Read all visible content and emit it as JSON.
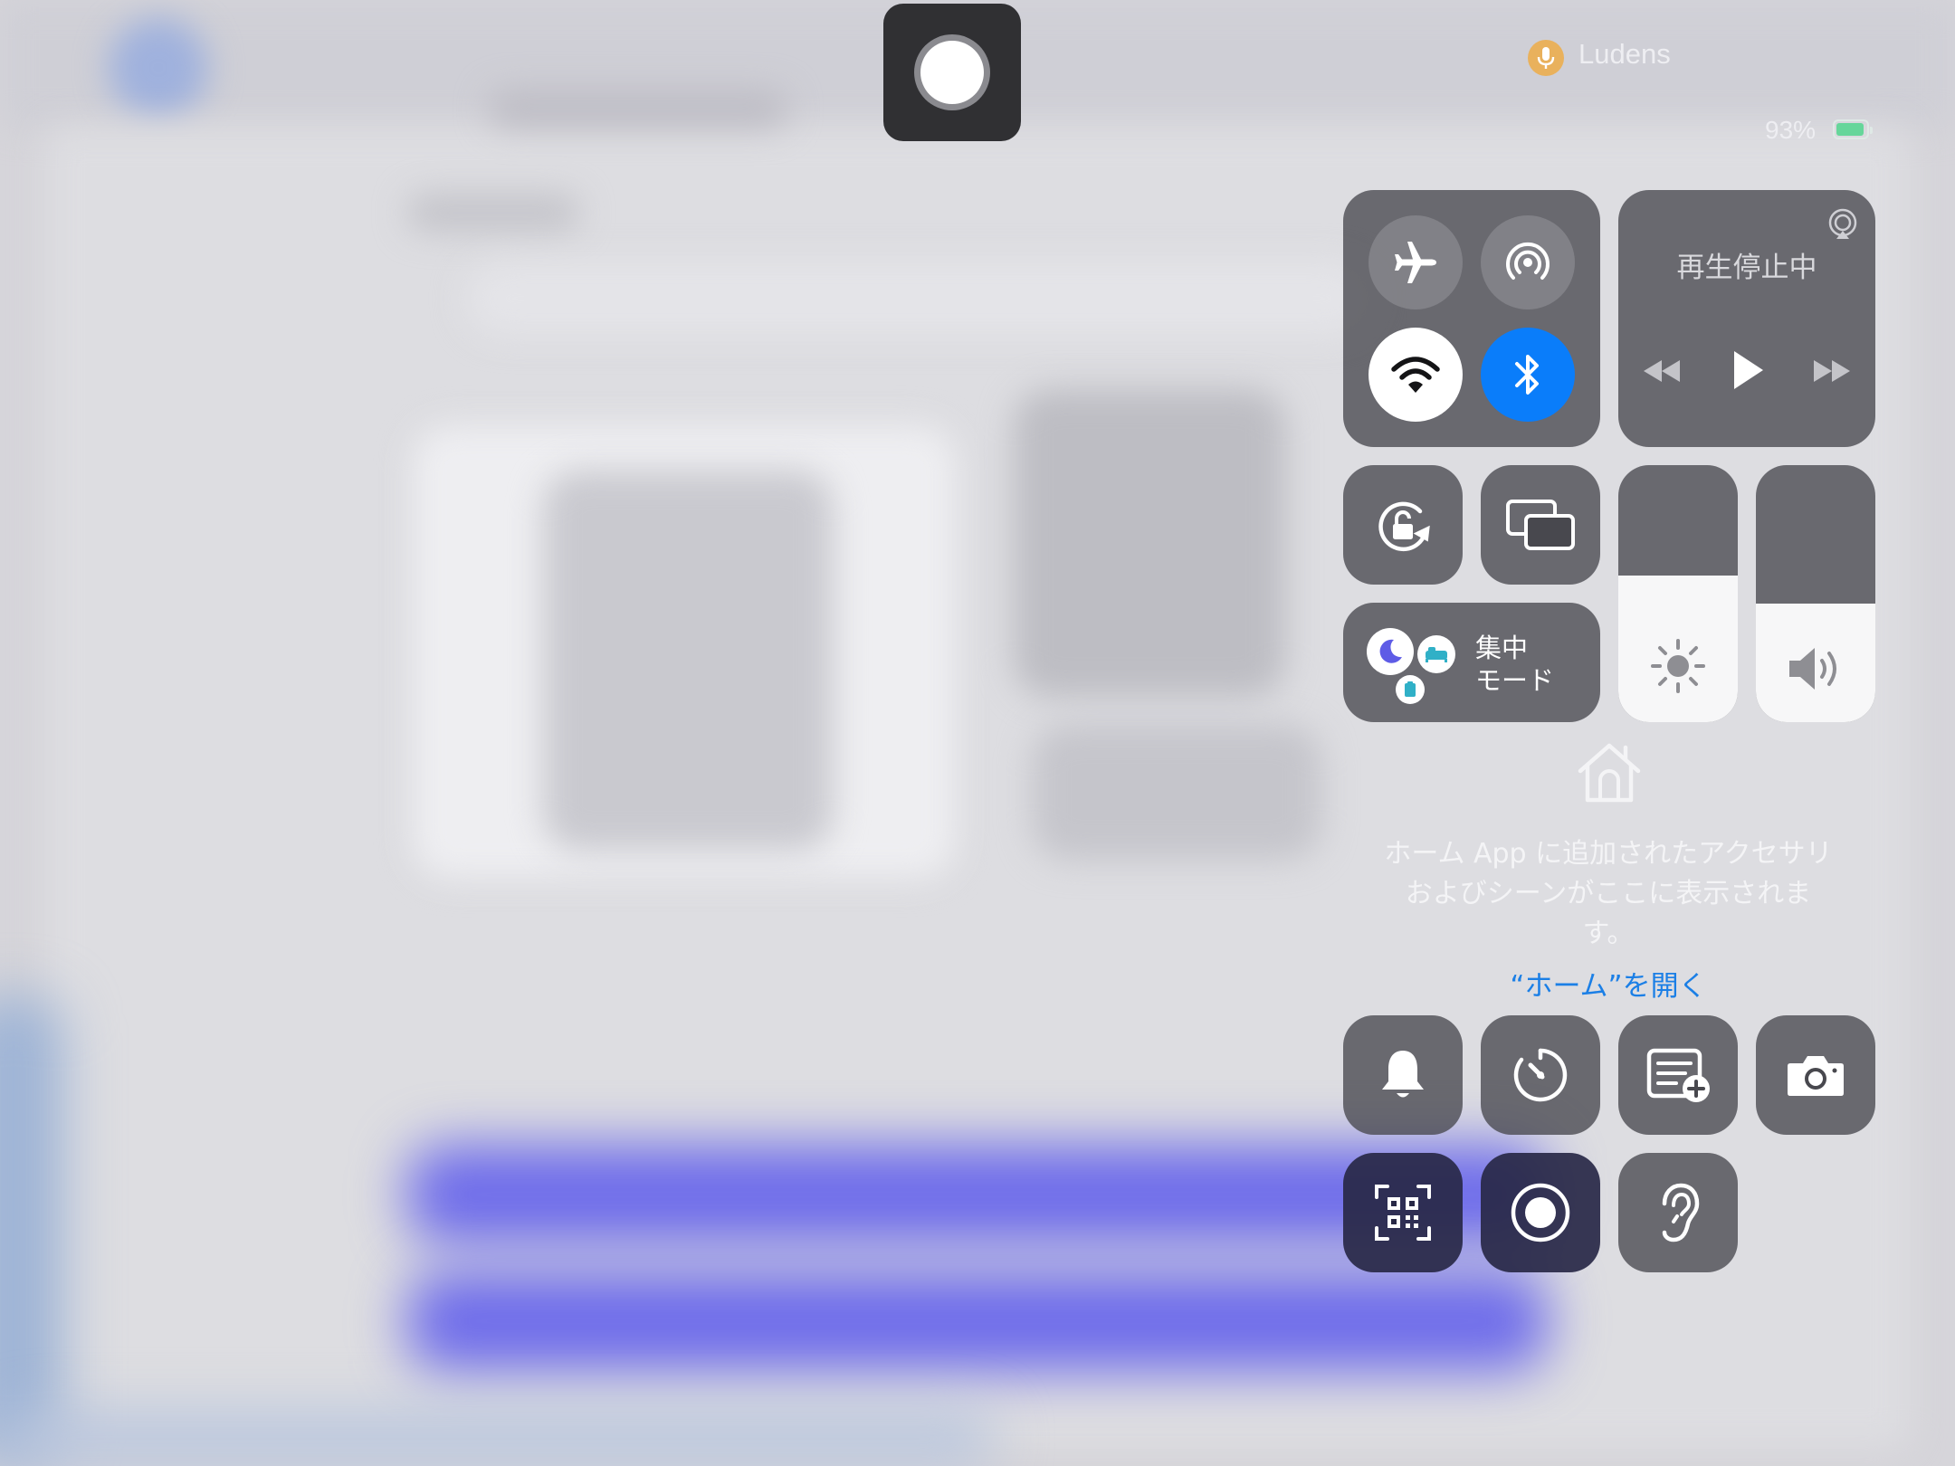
{
  "status_bar": {
    "active_app": "Ludens",
    "battery_percent": "93%",
    "battery_level": 0.93,
    "mic_icon": "microphone-icon"
  },
  "screen_recording": {
    "indicator_icon": "record-icon"
  },
  "control_center": {
    "connectivity": {
      "airplane_mode": {
        "icon": "airplane-icon",
        "on": false
      },
      "airdrop": {
        "icon": "airdrop-icon",
        "on": false
      },
      "wifi": {
        "icon": "wifi-icon",
        "on": true
      },
      "bluetooth": {
        "icon": "bluetooth-icon",
        "on": true
      }
    },
    "now_playing": {
      "title": "再生停止中",
      "airplay_icon": "airplay-icon",
      "controls": [
        "rewind-icon",
        "play-icon",
        "fast-forward-icon"
      ]
    },
    "orientation_lock_icon": "orientation-lock-icon",
    "screen_mirroring_icon": "screen-mirroring-icon",
    "focus": {
      "line1": "集中",
      "line2": "モード",
      "icon": "moon-icon"
    },
    "brightness": {
      "icon": "sun-icon",
      "level": 0.57
    },
    "volume": {
      "icon": "speaker-icon",
      "level": 0.46
    },
    "home": {
      "icon": "home-icon",
      "message_line1": "ホーム App に追加されたアクセサリ",
      "message_line2": "およびシーンがここに表示されま",
      "message_line3": "す。",
      "open_link": "“ホーム”を開く"
    },
    "shortcuts": [
      {
        "name": "silent-mode",
        "icon": "bell-icon"
      },
      {
        "name": "timer",
        "icon": "timer-icon"
      },
      {
        "name": "quick-note",
        "icon": "quick-note-icon"
      },
      {
        "name": "camera",
        "icon": "camera-icon"
      },
      {
        "name": "code-scanner",
        "icon": "qr-code-icon"
      },
      {
        "name": "screen-recording",
        "icon": "record-icon"
      },
      {
        "name": "hearing",
        "icon": "ear-icon"
      }
    ]
  }
}
